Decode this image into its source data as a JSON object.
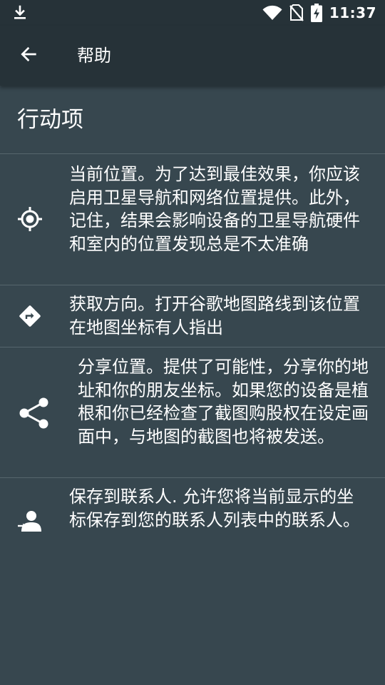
{
  "status_bar": {
    "time": "11:37",
    "icons": [
      "download-icon",
      "wifi-icon",
      "no-sim-icon",
      "battery-charging-icon"
    ]
  },
  "toolbar": {
    "back_icon": "arrow-left-icon",
    "title": "帮助"
  },
  "section": {
    "title": "行动项"
  },
  "items": [
    {
      "icon": "my-location-icon",
      "text": "当前位置。为了达到最佳效果，你应该启用卫星导航和网络位置提供。此外，记住，结果会影响设备的卫星导航硬件和室内的位置发现总是不太准确"
    },
    {
      "icon": "directions-icon",
      "text": "获取方向。打开谷歌地图路线到该位置在地图坐标有人指出"
    },
    {
      "icon": "share-icon",
      "text": "分享位置。提供了可能性，分享你的地址和你的朋友坐标。如果您的设备是植根和你已经检查了截图购股权在设定画面中，与地图的截图也将被发送。"
    },
    {
      "icon": "save-contact-icon",
      "text": "保存到联系人. 允许您将当前显示的坐标保存到您的联系人列表中的联系人。"
    }
  ],
  "colors": {
    "background": "#37474f",
    "bar": "#263238",
    "divider": "#56666d",
    "text": "#ffffff"
  }
}
